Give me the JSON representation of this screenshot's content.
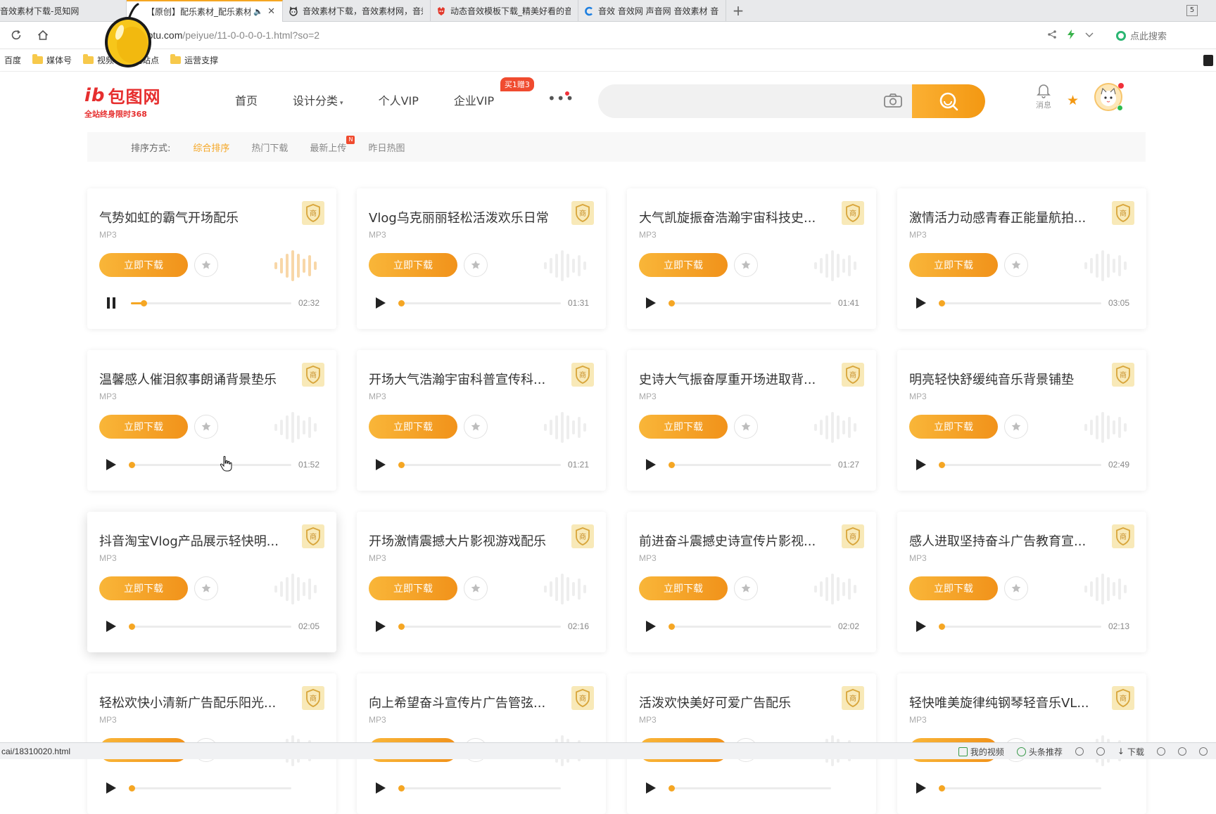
{
  "browser": {
    "tabs": [
      {
        "title": "音效素材下载-觅知网",
        "icon": "",
        "active": false
      },
      {
        "title": "【原创】配乐素材_配乐素材下",
        "icon": "mango-icon",
        "active": true,
        "audio": "🔈",
        "close": "✕"
      },
      {
        "title": "音效素材下载，音效素材网，音效",
        "icon": "cat-icon",
        "active": false
      },
      {
        "title": "动态音效模板下载_精美好看的音",
        "icon": "red-logo-icon",
        "active": false
      },
      {
        "title": "音效 音效网 声音网 音效素材 音",
        "icon": "c-logo-icon",
        "active": false
      }
    ],
    "tab_count": "5",
    "url_host": "baotu.com",
    "url_path": "/peiyue/11-0-0-0-0-1.html?so=2",
    "search_placeholder": "点此搜索",
    "bookmarks": [
      {
        "label": "百度",
        "folder": false
      },
      {
        "label": "媒体号",
        "folder": true
      },
      {
        "label": "视频",
        "folder": true
      },
      {
        "label": "贴吧站点",
        "folder": false
      },
      {
        "label": "运营支撑",
        "folder": true
      }
    ],
    "status_url": "cai/18310020.html",
    "status_items": [
      "我的视频",
      "头条推荐",
      "下载"
    ]
  },
  "site": {
    "logo_text": "包图网",
    "logo_sub": "全站终身限时368",
    "nav": [
      {
        "label": "首页"
      },
      {
        "label": "设计分类",
        "caret": "▾"
      },
      {
        "label": "个人VIP"
      },
      {
        "label": "企业VIP",
        "badge": "买1赠3"
      }
    ],
    "more": "•••",
    "messages_label": "消息"
  },
  "sort": {
    "label": "排序方式:",
    "options": [
      {
        "label": "综合排序",
        "active": true
      },
      {
        "label": "热门下载"
      },
      {
        "label": "最新上传",
        "badge": "N"
      },
      {
        "label": "昨日热图"
      }
    ]
  },
  "card_ui": {
    "download_label": "立即下载",
    "commercial_mark": "商"
  },
  "colors": {
    "accent": "#f5a623",
    "button_start": "#f9b639",
    "button_end": "#f1921a",
    "brand_red": "#e62e2e"
  },
  "cards": [
    {
      "title": "气势如虹的霸气开场配乐",
      "format": "MP3",
      "duration": "02:32",
      "playing": true,
      "progress": 0.05
    },
    {
      "title": "Vlog乌克丽丽轻松活泼欢乐日常",
      "format": "MP3",
      "duration": "01:31",
      "playing": false,
      "progress": 0
    },
    {
      "title": "大气凯旋振奋浩瀚宇宙科技史...",
      "format": "MP3",
      "duration": "01:41",
      "playing": false,
      "progress": 0
    },
    {
      "title": "激情活力动感青春正能量航拍...",
      "format": "MP3",
      "duration": "03:05",
      "playing": false,
      "progress": 0
    },
    {
      "title": "温馨感人催泪叙事朗诵背景垫乐",
      "format": "MP3",
      "duration": "01:52",
      "playing": false,
      "progress": 0
    },
    {
      "title": "开场大气浩瀚宇宙科普宣传科...",
      "format": "MP3",
      "duration": "01:21",
      "playing": false,
      "progress": 0
    },
    {
      "title": "史诗大气振奋厚重开场进取背...",
      "format": "MP3",
      "duration": "01:27",
      "playing": false,
      "progress": 0
    },
    {
      "title": "明亮轻快舒缓纯音乐背景铺垫",
      "format": "MP3",
      "duration": "02:49",
      "playing": false,
      "progress": 0
    },
    {
      "title": "抖音淘宝Vlog产品展示轻快明...",
      "format": "MP3",
      "duration": "02:05",
      "playing": false,
      "progress": 0
    },
    {
      "title": "开场激情震撼大片影视游戏配乐",
      "format": "MP3",
      "duration": "02:16",
      "playing": false,
      "progress": 0
    },
    {
      "title": "前进奋斗震撼史诗宣传片影视...",
      "format": "MP3",
      "duration": "02:02",
      "playing": false,
      "progress": 0
    },
    {
      "title": "感人进取坚持奋斗广告教育宣...",
      "format": "MP3",
      "duration": "02:13",
      "playing": false,
      "progress": 0
    },
    {
      "title": "轻松欢快小清新广告配乐阳光...",
      "format": "MP3",
      "duration": "",
      "playing": false,
      "progress": 0
    },
    {
      "title": "向上希望奋斗宣传片广告管弦...",
      "format": "MP3",
      "duration": "",
      "playing": false,
      "progress": 0
    },
    {
      "title": "活泼欢快美好可爱广告配乐",
      "format": "MP3",
      "duration": "",
      "playing": false,
      "progress": 0
    },
    {
      "title": "轻快唯美旋律纯钢琴轻音乐VL...",
      "format": "MP3",
      "duration": "",
      "playing": false,
      "progress": 0
    }
  ]
}
